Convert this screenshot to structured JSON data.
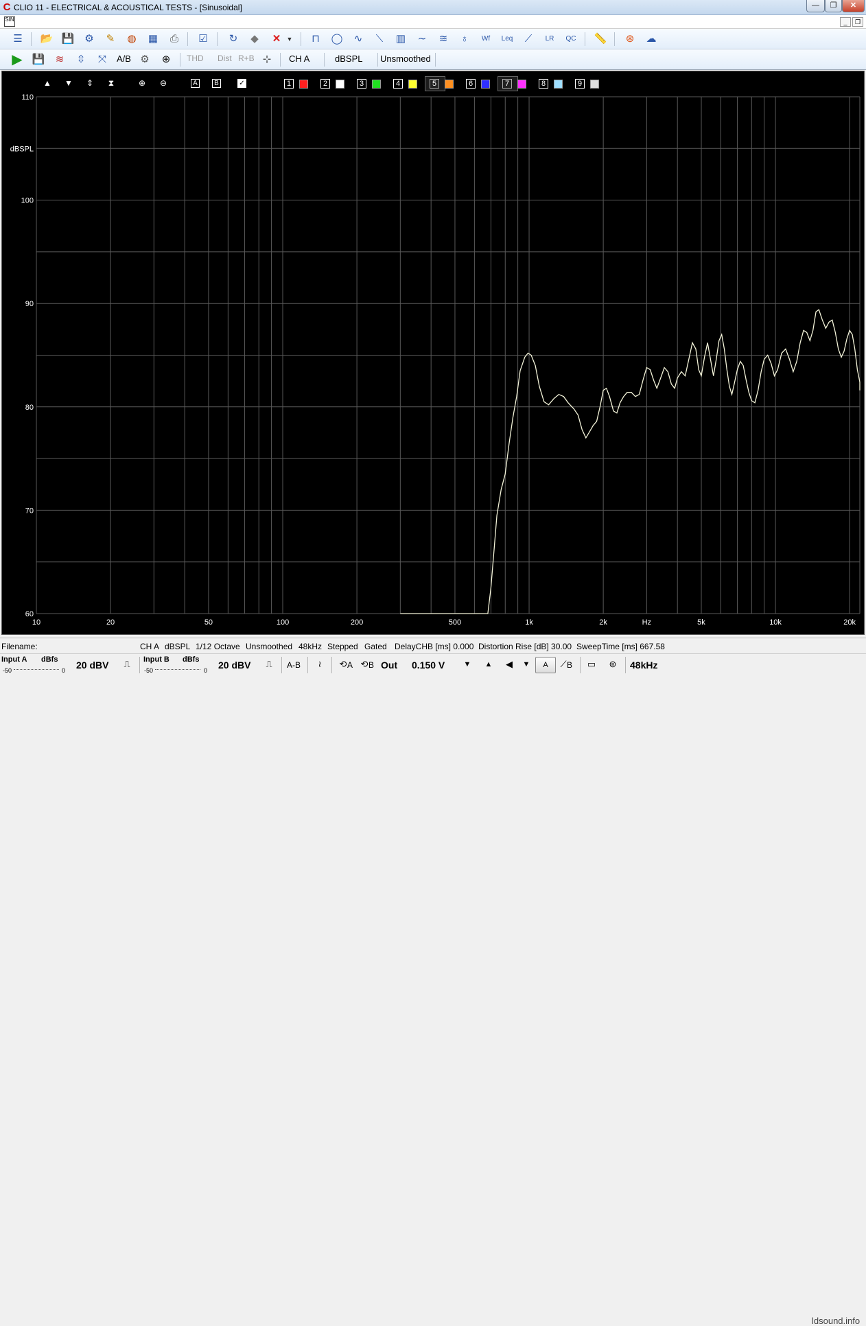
{
  "window": {
    "app_icon": "C",
    "title": "CLIO 11 - ELECTRICAL & ACOUSTICAL TESTS - [Sinusoidal]",
    "min": "—",
    "max": "❐",
    "close": "✕",
    "mdi_icon": "SIN",
    "mdi_min": "_",
    "mdi_restore": "❐"
  },
  "toolbar1": {
    "icons": [
      "menu-icon",
      "open-folder-icon",
      "save-icon",
      "settings-save-icon",
      "edit-icon",
      "color-icon",
      "calendar-icon",
      "print-icon",
      "checklist-icon",
      "refresh-icon",
      "eraser-icon",
      "delete-icon",
      "dropdown-arrow-icon",
      "mls-icon",
      "fft-icon",
      "sinusoidal-icon",
      "impulse-icon",
      "waterfall-icon",
      "sine-wave-icon",
      "wave-icon",
      "microphone-icon",
      "wf-icon",
      "leq-icon",
      "slope-icon",
      "lr-icon",
      "qc-icon",
      "ruler-icon",
      "help-icon",
      "web-icon"
    ]
  },
  "toolbar2": {
    "ab_label": "A/B",
    "thd_label": "THD",
    "dist_label": "Dist",
    "rb_label": "R+B",
    "channel_label": "CH A",
    "unit_label": "dBSPL",
    "smoothing_label": "Unsmoothed"
  },
  "chart_toolbar": {
    "box_a": "A",
    "box_b": "B",
    "overlays": [
      {
        "num": "1",
        "color": "#ff2020"
      },
      {
        "num": "2",
        "color": "#ffffff"
      },
      {
        "num": "3",
        "color": "#20e020"
      },
      {
        "num": "4",
        "color": "#ffff30"
      },
      {
        "num": "5",
        "color": "#ff9020"
      },
      {
        "num": "6",
        "color": "#3030ff"
      },
      {
        "num": "7",
        "color": "#ff30ff"
      },
      {
        "num": "8",
        "color": "#a0e0ff"
      },
      {
        "num": "9",
        "color": "#e0e0e0"
      }
    ]
  },
  "chart_data": {
    "type": "line",
    "xlabel": "Hz",
    "ylabel": "dBSPL",
    "xscale": "log",
    "xlim": [
      10,
      22000
    ],
    "ylim": [
      60,
      110
    ],
    "x_ticks": [
      10,
      20,
      50,
      100,
      200,
      500,
      1000,
      2000,
      5000,
      10000,
      20000
    ],
    "x_tick_labels": [
      "10",
      "20",
      "50",
      "100",
      "200",
      "500",
      "1k",
      "2k",
      "5k",
      "10k",
      "20k"
    ],
    "y_ticks": [
      60,
      70,
      80,
      90,
      100,
      110
    ],
    "y_tick_labels": [
      "60",
      "70",
      "80",
      "90",
      "100",
      "110"
    ],
    "grid": true,
    "background": "#000000",
    "grid_color": "#5a5a5a",
    "series": [
      {
        "color": "#f2f2d8",
        "points": [
          [
            300,
            60.0
          ],
          [
            400,
            60.0
          ],
          [
            500,
            60.0
          ],
          [
            600,
            60.0
          ],
          [
            680,
            60.0
          ],
          [
            700,
            62.5
          ],
          [
            720,
            66.0
          ],
          [
            740,
            69.5
          ],
          [
            770,
            72.0
          ],
          [
            800,
            73.5
          ],
          [
            830,
            76.5
          ],
          [
            860,
            79.0
          ],
          [
            890,
            81.0
          ],
          [
            920,
            83.5
          ],
          [
            960,
            84.8
          ],
          [
            990,
            85.2
          ],
          [
            1020,
            85.0
          ],
          [
            1060,
            84.0
          ],
          [
            1100,
            82.0
          ],
          [
            1150,
            80.5
          ],
          [
            1200,
            80.2
          ],
          [
            1260,
            80.8
          ],
          [
            1320,
            81.2
          ],
          [
            1380,
            81.0
          ],
          [
            1440,
            80.4
          ],
          [
            1520,
            79.8
          ],
          [
            1580,
            79.2
          ],
          [
            1640,
            77.8
          ],
          [
            1700,
            77.0
          ],
          [
            1760,
            77.6
          ],
          [
            1820,
            78.2
          ],
          [
            1880,
            78.6
          ],
          [
            1940,
            80.0
          ],
          [
            2000,
            81.6
          ],
          [
            2060,
            81.8
          ],
          [
            2120,
            81.0
          ],
          [
            2200,
            79.6
          ],
          [
            2270,
            79.4
          ],
          [
            2340,
            80.4
          ],
          [
            2420,
            81.0
          ],
          [
            2500,
            81.4
          ],
          [
            2600,
            81.4
          ],
          [
            2700,
            81.0
          ],
          [
            2800,
            81.2
          ],
          [
            2900,
            82.6
          ],
          [
            3000,
            83.8
          ],
          [
            3100,
            83.6
          ],
          [
            3200,
            82.6
          ],
          [
            3300,
            81.8
          ],
          [
            3420,
            82.8
          ],
          [
            3540,
            83.8
          ],
          [
            3660,
            83.4
          ],
          [
            3780,
            82.2
          ],
          [
            3900,
            81.8
          ],
          [
            4000,
            82.8
          ],
          [
            4150,
            83.4
          ],
          [
            4300,
            83.0
          ],
          [
            4450,
            84.6
          ],
          [
            4600,
            86.2
          ],
          [
            4750,
            85.6
          ],
          [
            4880,
            83.6
          ],
          [
            5000,
            83.0
          ],
          [
            5150,
            84.8
          ],
          [
            5300,
            86.2
          ],
          [
            5450,
            84.6
          ],
          [
            5600,
            83.0
          ],
          [
            5750,
            84.6
          ],
          [
            5900,
            86.4
          ],
          [
            6050,
            87.0
          ],
          [
            6200,
            85.6
          ],
          [
            6350,
            83.6
          ],
          [
            6500,
            82.0
          ],
          [
            6650,
            81.2
          ],
          [
            6800,
            82.2
          ],
          [
            7000,
            83.6
          ],
          [
            7200,
            84.4
          ],
          [
            7400,
            84.0
          ],
          [
            7600,
            82.6
          ],
          [
            7800,
            81.4
          ],
          [
            8000,
            80.6
          ],
          [
            8250,
            80.4
          ],
          [
            8500,
            81.6
          ],
          [
            8750,
            83.4
          ],
          [
            9000,
            84.6
          ],
          [
            9300,
            85.0
          ],
          [
            9600,
            84.2
          ],
          [
            9900,
            83.0
          ],
          [
            10200,
            83.6
          ],
          [
            10600,
            85.2
          ],
          [
            11000,
            85.6
          ],
          [
            11400,
            84.6
          ],
          [
            11800,
            83.4
          ],
          [
            12200,
            84.4
          ],
          [
            12600,
            86.2
          ],
          [
            13000,
            87.4
          ],
          [
            13400,
            87.2
          ],
          [
            13800,
            86.4
          ],
          [
            14200,
            87.4
          ],
          [
            14600,
            89.2
          ],
          [
            15000,
            89.4
          ],
          [
            15500,
            88.4
          ],
          [
            16000,
            87.6
          ],
          [
            16500,
            88.2
          ],
          [
            17000,
            88.4
          ],
          [
            17500,
            87.2
          ],
          [
            18000,
            85.6
          ],
          [
            18500,
            84.8
          ],
          [
            19000,
            85.4
          ],
          [
            19500,
            86.6
          ],
          [
            20000,
            87.4
          ],
          [
            20500,
            87.0
          ],
          [
            21000,
            85.6
          ],
          [
            21500,
            83.6
          ],
          [
            22000,
            82.4
          ],
          [
            22500,
            82.0
          ],
          [
            23000,
            81.6
          ]
        ]
      }
    ]
  },
  "status": {
    "filename_label": "Filename:",
    "channel": "CH A",
    "unit": "dBSPL",
    "octave": "1/12 Octave",
    "smoothing": "Unsmoothed",
    "rate": "48kHz",
    "mode": "Stepped",
    "gating": "Gated",
    "delay": "DelayCHB [ms] 0.000",
    "distortion": "Distortion Rise [dB] 30.00",
    "sweep": "SweepTime [ms] 667.58"
  },
  "bottom": {
    "input_a_label": "Input A",
    "input_a_unit": "dBfs",
    "input_a_min": "-50",
    "input_a_max": "0",
    "input_a_range": "20 dBV",
    "input_b_label": "Input B",
    "input_b_unit": "dBfs",
    "input_b_min": "-50",
    "input_b_max": "0",
    "input_b_range": "20 dBV",
    "ab_label": "A-B",
    "ca_label": "A",
    "cb_label": "B",
    "out_label": "Out",
    "out_level": "0.150 V",
    "sel_a": "A",
    "sel_b": "B",
    "rate": "48kHz",
    "watermark": "ldsound.info"
  }
}
